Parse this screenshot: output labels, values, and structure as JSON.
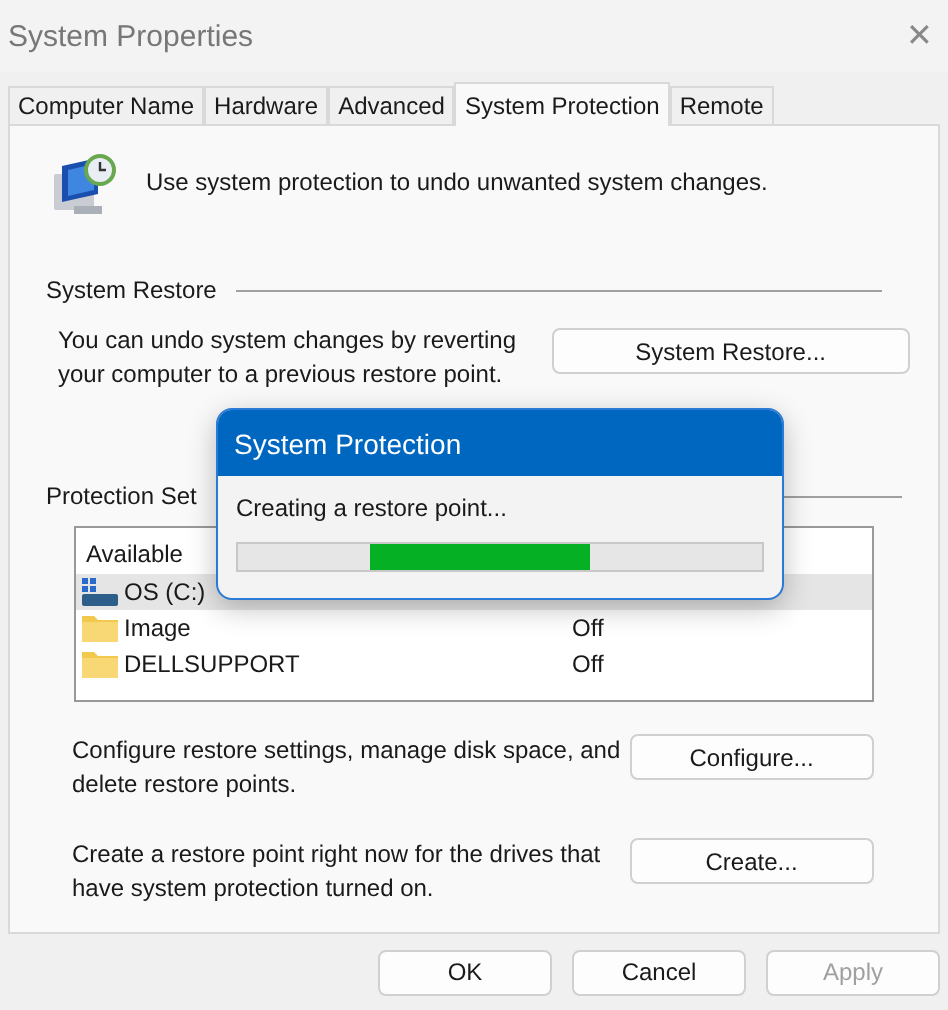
{
  "window": {
    "title": "System Properties",
    "close": "✕"
  },
  "tabs": [
    {
      "label": "Computer Name",
      "selected": false
    },
    {
      "label": "Hardware",
      "selected": false
    },
    {
      "label": "Advanced",
      "selected": false
    },
    {
      "label": "System Protection",
      "selected": true
    },
    {
      "label": "Remote",
      "selected": false
    }
  ],
  "intro": "Use system protection to undo unwanted system changes.",
  "system_restore": {
    "heading": "System Restore",
    "text": "You can undo system changes by reverting your computer to a previous restore point.",
    "button": "System Restore..."
  },
  "protection_settings": {
    "heading": "Protection Set",
    "column_1": "Available",
    "rows": [
      {
        "kind": "drive",
        "name": "OS (C:)",
        "selected": true
      },
      {
        "kind": "folder",
        "name": "Image",
        "protection": "Off",
        "selected": false
      },
      {
        "kind": "folder",
        "name": "DELLSUPPORT",
        "protection": "Off",
        "selected": false
      }
    ],
    "configure_text": "Configure restore settings, manage disk space, and delete restore points.",
    "configure_button": "Configure...",
    "create_text": "Create a restore point right now for the drives that have system protection turned on.",
    "create_button": "Create..."
  },
  "buttons": [
    {
      "label": "OK",
      "disabled": false
    },
    {
      "label": "Cancel",
      "disabled": false
    },
    {
      "label": "Apply",
      "disabled": true
    }
  ],
  "progress_dialog": {
    "title": "System Protection",
    "message": "Creating a restore point...",
    "level": 0.42
  }
}
